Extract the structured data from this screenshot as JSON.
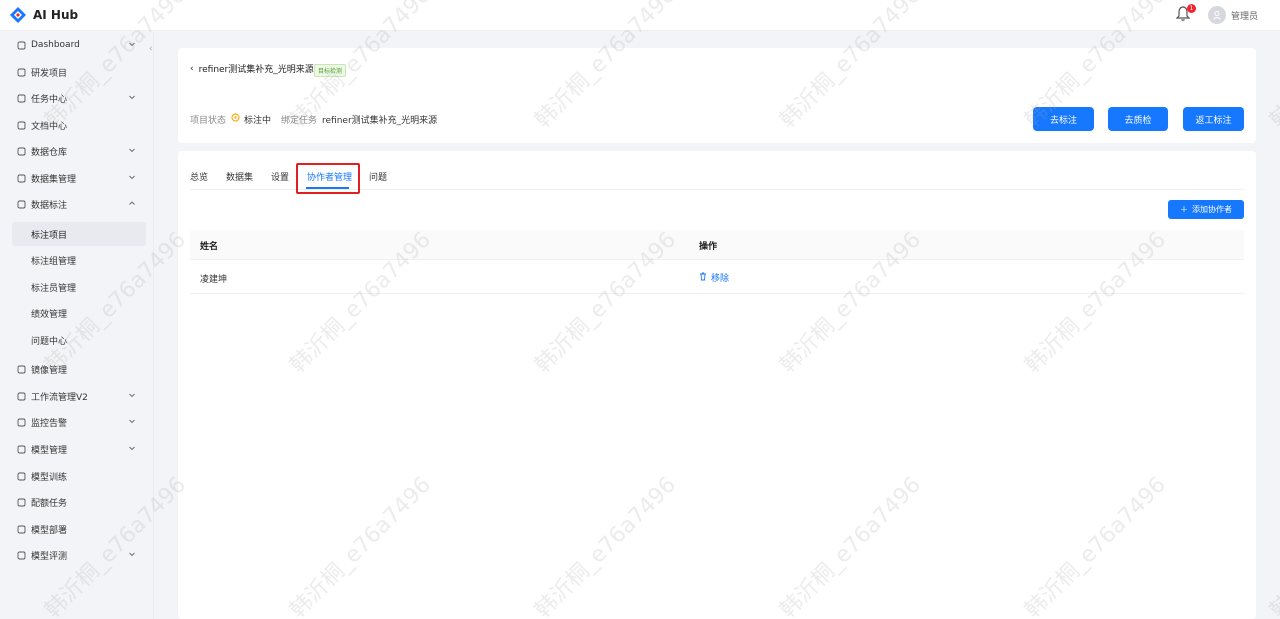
{
  "app": {
    "name": "AI Hub"
  },
  "topbar": {
    "notification_count": "1",
    "username": "管理员"
  },
  "sidebar": {
    "items": [
      {
        "label": "Dashboard",
        "icon": "dashboard-icon",
        "expandable": true
      },
      {
        "label": "研发项目",
        "icon": "folder-icon",
        "expandable": false
      },
      {
        "label": "任务中心",
        "icon": "calendar-icon",
        "expandable": true
      },
      {
        "label": "文档中心",
        "icon": "document-icon",
        "expandable": false
      },
      {
        "label": "数据仓库",
        "icon": "home-icon",
        "expandable": true
      },
      {
        "label": "数据集管理",
        "icon": "database-icon",
        "expandable": true
      },
      {
        "label": "数据标注",
        "icon": "brush-icon",
        "expandable": true,
        "expanded": true
      },
      {
        "label": "标注项目",
        "sub": true,
        "active": true
      },
      {
        "label": "标注组管理",
        "sub": true
      },
      {
        "label": "标注员管理",
        "sub": true
      },
      {
        "label": "绩效管理",
        "sub": true
      },
      {
        "label": "问题中心",
        "sub": true
      },
      {
        "label": "镜像管理",
        "icon": "docker-icon",
        "expandable": false
      },
      {
        "label": "工作流管理V2",
        "icon": "workflow-icon",
        "expandable": true
      },
      {
        "label": "监控告警",
        "icon": "warning-icon",
        "expandable": true
      },
      {
        "label": "模型管理",
        "icon": "model-icon",
        "expandable": true
      },
      {
        "label": "模型训练",
        "icon": "cluster-icon",
        "expandable": false
      },
      {
        "label": "配额任务",
        "icon": "check-circle-icon",
        "expandable": false
      },
      {
        "label": "模型部署",
        "icon": "cube-icon",
        "expandable": false
      },
      {
        "label": "模型评测",
        "icon": "chart-icon",
        "expandable": true
      }
    ]
  },
  "header": {
    "title": "refiner测试集补充_光明来源",
    "tag": "目标检测",
    "status_label": "项目状态",
    "status_value": "标注中",
    "task_label": "绑定任务",
    "task_value": "refiner测试集补充_光明来源",
    "buttons": {
      "annotate": "去标注",
      "qc": "去质检",
      "rework": "返工标注"
    }
  },
  "tabs": [
    {
      "label": "总览",
      "active": false
    },
    {
      "label": "数据集",
      "active": false
    },
    {
      "label": "设置",
      "active": false
    },
    {
      "label": "协作者管理",
      "active": true
    },
    {
      "label": "问题",
      "active": false
    }
  ],
  "collaborators": {
    "add_button": "添加协作者",
    "columns": [
      "姓名",
      "操作"
    ],
    "rows": [
      {
        "name": "凌建坤",
        "action": "移除"
      }
    ]
  },
  "watermark": "韩沂桐_e76a7496",
  "colors": {
    "primary": "#1677ff",
    "highlight": "#e02020",
    "tag_green": "#52a135"
  }
}
